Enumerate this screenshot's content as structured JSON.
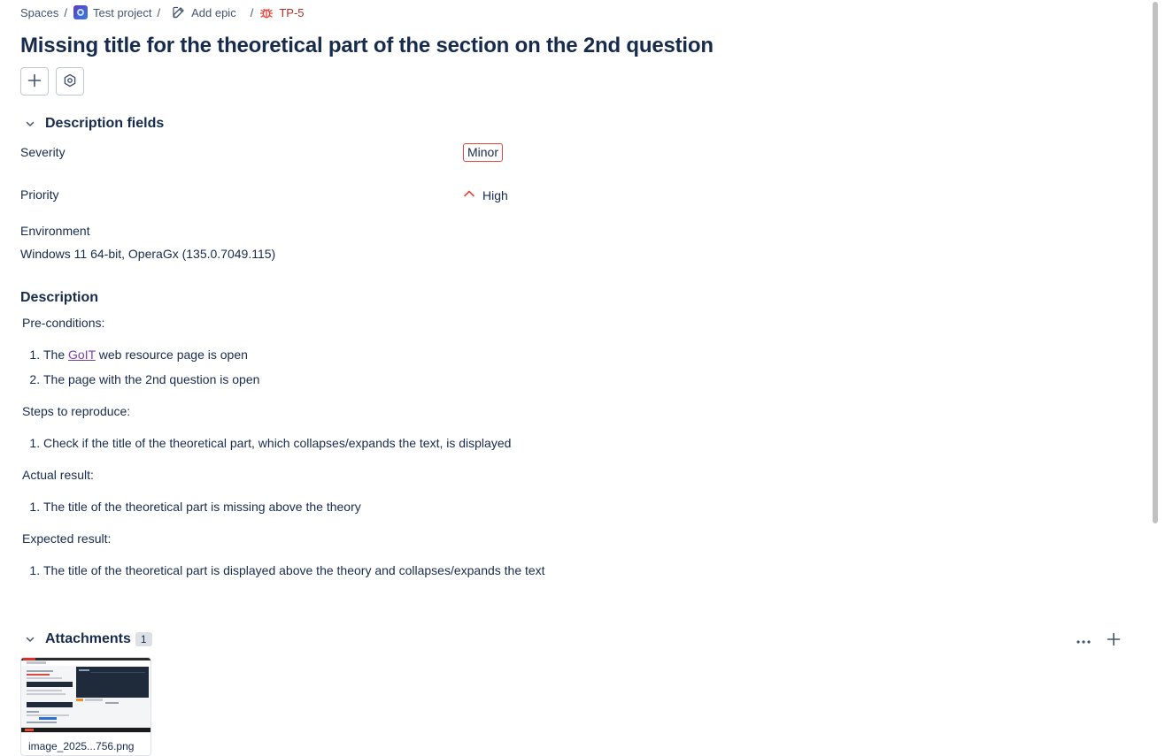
{
  "breadcrumb": {
    "spaces": "Spaces",
    "project": "Test project",
    "epic": "Add epic",
    "issue": "TP-5",
    "separator": "/"
  },
  "issue": {
    "title": "Missing title for the theoretical part of the section on the 2nd question"
  },
  "toolbar": {
    "add_icon": "plus-icon",
    "apps_icon": "hexagon-icon"
  },
  "description_fields": {
    "heading": "Description fields",
    "severity_label": "Severity",
    "severity_value": "Minor",
    "priority_label": "Priority",
    "priority_value": "High",
    "environment_label": "Environment",
    "environment_value": "Windows 11 64-bit, OperaGx (135.0.7049.115)"
  },
  "description": {
    "heading": "Description",
    "preconditions_label": "Pre-conditions:",
    "pre1_before": "The ",
    "pre1_link": "GoIT",
    "pre1_after": " web resource page is open",
    "pre2": "The page with the 2nd question is open",
    "steps_label": "Steps to reproduce:",
    "step1": "Check if the title of the theoretical part, which collapses/expands the text, is displayed",
    "actual_label": "Actual result:",
    "actual1": "The title of the theoretical part is missing above the theory",
    "expected_label": "Expected result:",
    "expected1": "The title of the theoretical part is displayed above the theory and collapses/expands the text"
  },
  "attachments": {
    "heading": "Attachments",
    "count": "1",
    "items": [
      {
        "name": "image_2025...756.png"
      }
    ]
  },
  "colors": {
    "text": "#172b4d",
    "severity_border": "#e2483d",
    "priority_high": "#e2483d",
    "link": "#7b3fa8",
    "bug": "#e2483d"
  }
}
